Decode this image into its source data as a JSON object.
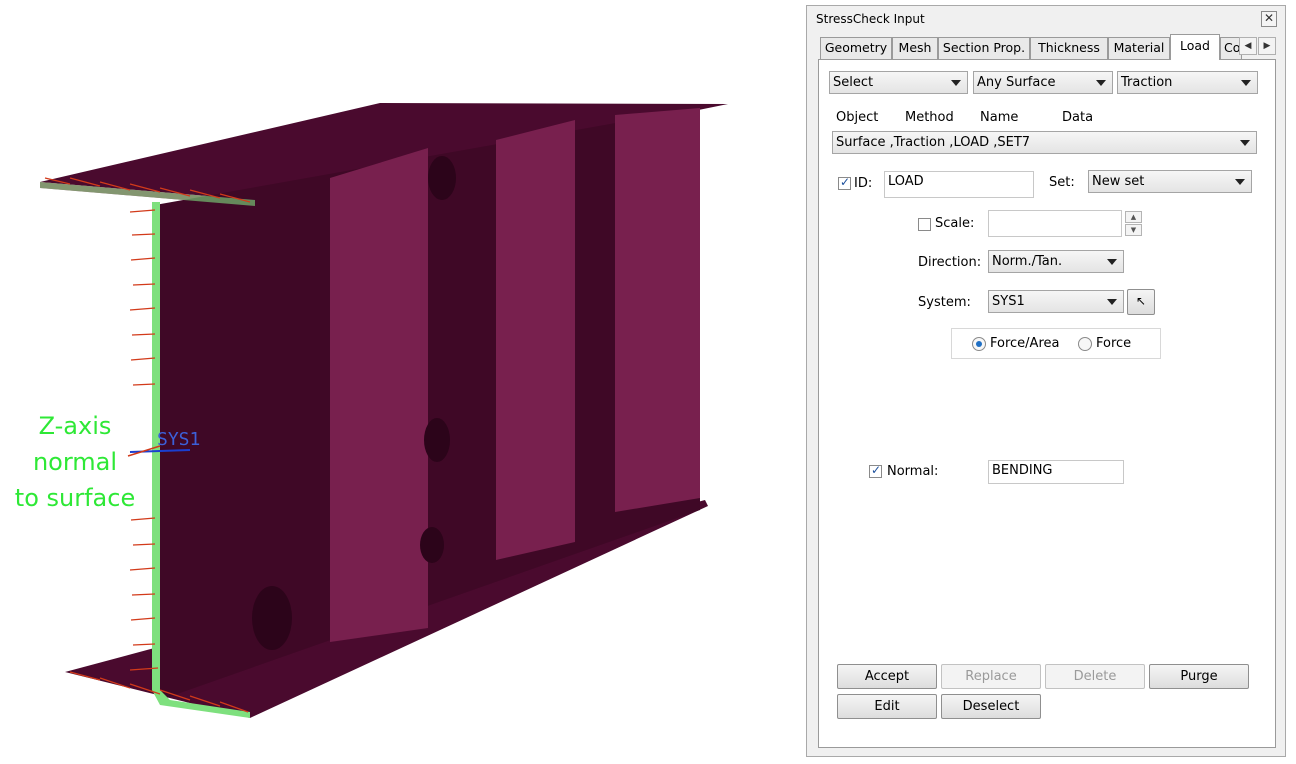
{
  "viewport": {
    "annotation_lines": [
      "Z-axis",
      "normal",
      "to surface"
    ],
    "sys_label": "SYS1",
    "colors": {
      "beam": "#4a0a2e",
      "beam_light": "#78204e",
      "highlight": "#7ee07e",
      "arrows": "#d23a1a",
      "annotation": "#2ee836"
    }
  },
  "window": {
    "title": "StressCheck Input",
    "close_icon": "close-icon",
    "tabs": [
      "Geometry",
      "Mesh",
      "Section Prop.",
      "Thickness",
      "Material",
      "Load",
      "Co"
    ],
    "active_tab": "Load",
    "scroll_icons": [
      "chevron-left-icon",
      "chevron-right-icon"
    ]
  },
  "form": {
    "select_mode": "Select",
    "surface_filter": "Any Surface",
    "load_type": "Traction",
    "header_object": "Object",
    "header_method": "Method",
    "header_name": "Name",
    "header_data": "Data",
    "record": "Surface  ,Traction  ,LOAD  ,SET7",
    "id_label": "ID:",
    "id_checked": true,
    "id_value": "LOAD",
    "set_label": "Set:",
    "set_value": "New set",
    "scale_label": "Scale:",
    "scale_checked": false,
    "scale_value": "",
    "direction_label": "Direction:",
    "direction_value": "Norm./Tan.",
    "system_label": "System:",
    "system_value": "SYS1",
    "pick_icon": "cursor-icon",
    "radio_force_area": "Force/Area",
    "radio_force": "Force",
    "radio_selected": "Force/Area",
    "normal_label": "Normal:",
    "normal_checked": true,
    "normal_value": "BENDING"
  },
  "buttons": {
    "accept": "Accept",
    "replace": "Replace",
    "delete": "Delete",
    "purge": "Purge",
    "edit": "Edit",
    "deselect": "Deselect"
  }
}
